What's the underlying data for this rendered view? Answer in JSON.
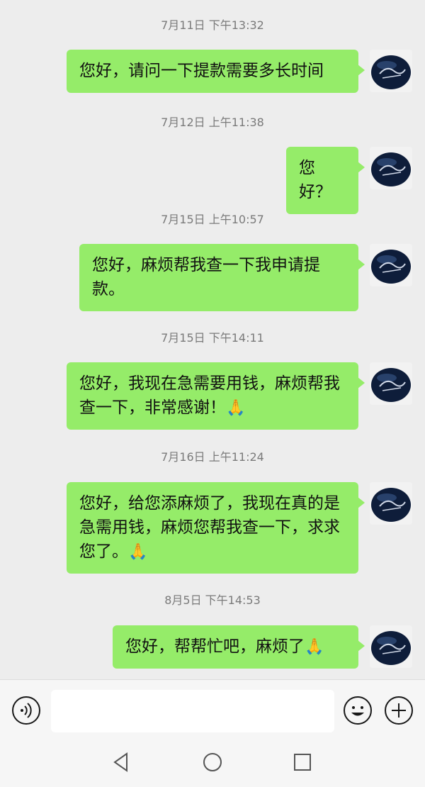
{
  "messages": [
    {
      "time": "7月11日 下午13:32",
      "text": "您好，请问一下提款需要多长时间",
      "emoji": ""
    },
    {
      "time": "7月12日 上午11:38",
      "text": "您好？",
      "emoji": ""
    },
    {
      "time": "7月15日 上午10:57",
      "text": "您好，麻烦帮我查一下我申请提款。",
      "emoji": ""
    },
    {
      "time": "7月15日 下午14:11",
      "text": "您好，我现在急需要用钱，麻烦帮我查一下，非常感谢！",
      "emoji": "🙏"
    },
    {
      "time": "7月16日 上午11:24",
      "text": "您好，给您添麻烦了，我现在真的是急需用钱，麻烦您帮我查一下，求求您了。",
      "emoji": "🙏"
    },
    {
      "time": "8月5日 下午14:53",
      "text": "您好，帮帮忙吧，麻烦了",
      "emoji": "🙏"
    }
  ],
  "input": {
    "value": "",
    "placeholder": ""
  },
  "icons": {
    "voice": "voice-icon",
    "emoji": "emoji-icon",
    "plus": "plus-icon",
    "back": "nav-back-icon",
    "home": "nav-home-icon",
    "recent": "nav-recent-icon"
  },
  "colors": {
    "background": "#ededed",
    "bubble": "#95ec69",
    "timestamp": "#7a7a7a"
  }
}
